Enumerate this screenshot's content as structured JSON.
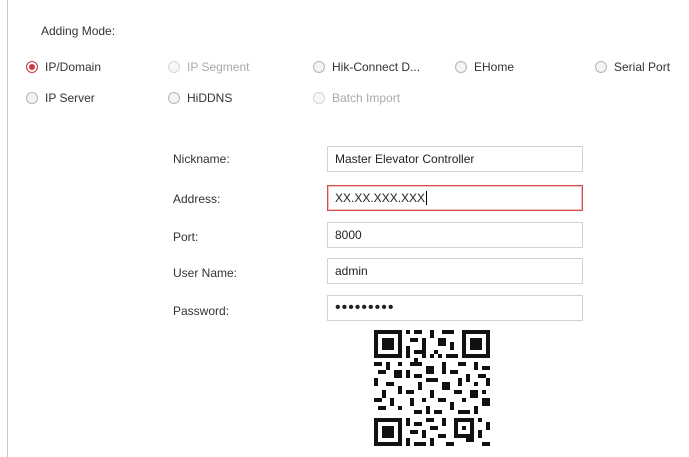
{
  "adding_mode": {
    "label": "Adding Mode:",
    "options": [
      {
        "label": "IP/Domain",
        "checked": true,
        "disabled": false
      },
      {
        "label": "IP Segment",
        "checked": false,
        "disabled": true
      },
      {
        "label": "Hik-Connect D...",
        "checked": false,
        "disabled": false
      },
      {
        "label": "EHome",
        "checked": false,
        "disabled": false
      },
      {
        "label": "Serial Port",
        "checked": false,
        "disabled": false
      },
      {
        "label": "IP Server",
        "checked": false,
        "disabled": false
      },
      {
        "label": "HiDDNS",
        "checked": false,
        "disabled": false
      },
      {
        "label": "Batch Import",
        "checked": false,
        "disabled": true
      }
    ]
  },
  "form": {
    "nickname_label": "Nickname:",
    "nickname_value": "Master Elevator Controller",
    "address_label": "Address:",
    "address_value": "XX.XX.XXX.XXX",
    "port_label": "Port:",
    "port_value": "8000",
    "username_label": "User Name:",
    "username_value": "admin",
    "password_label": "Password:",
    "password_value": "•••••••••"
  },
  "colors": {
    "accent_red": "#d23a3a",
    "border": "#d2d2d2"
  },
  "icons": {
    "qr": "qr-code-icon"
  }
}
